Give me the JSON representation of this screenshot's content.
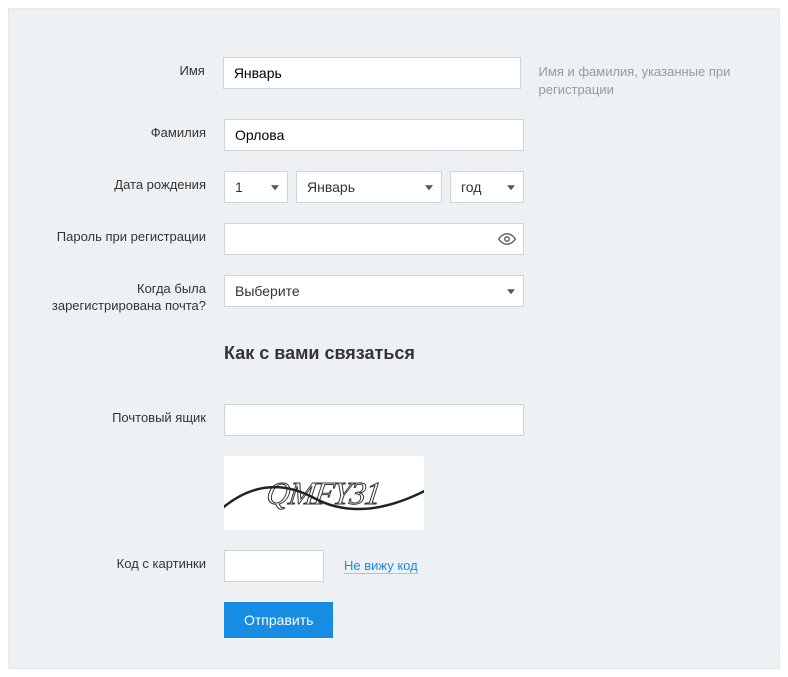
{
  "labels": {
    "firstname": "Имя",
    "lastname": "Фамилия",
    "birthdate": "Дата рождения",
    "password": "Пароль при регистрации",
    "when_registered": "Когда была зарегистрирована почта?",
    "email": "Почтовый ящик",
    "captcha_code": "Код с картинки"
  },
  "values": {
    "firstname": "Январь",
    "lastname": "Орлова",
    "day": "1",
    "month": "Январь",
    "year": "год",
    "password": "",
    "when_registered": "Выберите",
    "email": "",
    "captcha_code": ""
  },
  "section_heading": "Как с вами связаться",
  "hint": "Имя и фамилия, указанные при регистрации",
  "captcha_text": "QMFY31",
  "links": {
    "cant_see": "Не вижу код"
  },
  "buttons": {
    "submit": "Отправить"
  }
}
